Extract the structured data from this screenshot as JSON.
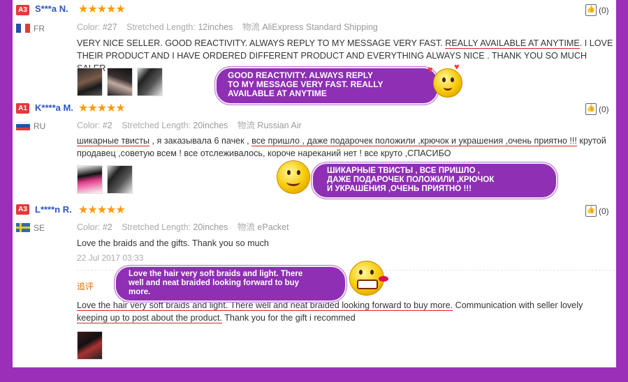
{
  "reviews": [
    {
      "badge": "A3",
      "name": "S***a N.",
      "stars": "★★★★★",
      "country": "FR",
      "likes": "(0)",
      "color_label": "Color:",
      "color_value": "#27",
      "length_label": "Stretched Length:",
      "length_value": "12inches",
      "ship_label": "物流",
      "ship_value": "AliExpress Standard Shipping",
      "text_a": "VERY NICE SELLER. GOOD REACTIVITY. ALWAYS REPLY TO MY MESSAGE VERY FAST. ",
      "text_u": "REALLY AVAILABLE AT ANYTIME",
      "text_b": ". I LOVE THEIR PRODUCT AND I HAVE ORDERED DIFFERENT PRODUCT AND EVERYTHING ALWAYS NICE . THANK YOU SO MUCH SALER",
      "bubble": "GOOD REACTIVITY. ALWAYS REPLY\nTO MY MESSAGE VERY FAST. REALLY\nAVAILABLE AT ANYTIME"
    },
    {
      "badge": "A1",
      "name": "K****a M.",
      "stars": "★★★★★",
      "country": "RU",
      "likes": "(0)",
      "color_label": "Color:",
      "color_value": "#2",
      "length_label": "Stretched Length:",
      "length_value": "20inches",
      "ship_label": "物流",
      "ship_value": "Russian Air",
      "t1": "шикарные твисты",
      "t2": " , я заказывала 6 пачек , ",
      "t3": "все пришло , даже подарочек положили ,крючок и украшения ,очень приятно !!!",
      "t4": " крутой продавец ,советую всем ! все отслеживалось, короче нареканий нет ! все круто ,СПАСИБО",
      "bubble": "ШИКАРНЫЕ ТВИСТЫ , ВСЕ ПРИШЛО ,\nДАЖЕ ПОДАРОЧЕК ПОЛОЖИЛИ ,КРЮЧОК\nИ УКРАШЕНИЯ ,ОЧЕНЬ ПРИЯТНО !!!"
    },
    {
      "badge": "A3",
      "name": "L****n R.",
      "stars": "★★★★★",
      "country": "SE",
      "likes": "(0)",
      "color_label": "Color:",
      "color_value": "#2",
      "length_label": "Stretched Length:",
      "length_value": "20inches",
      "ship_label": "物流",
      "ship_value": "ePacket",
      "text": "Love the braids and the gifts. Thank you so much",
      "date": "22 Jul 2017 03:33",
      "followup_label": "追评",
      "f1": "Love the hair very soft braids and light. There well and neat braided looking forward to buy more.",
      "f2": " Communication with seller lovely ",
      "f3": "keeping up to post about the product.",
      "f4": " Thank you for the gift i recommed",
      "bubble": "Love the hair very soft braids and light. There\nwell and neat braided looking forward to buy\nmore."
    }
  ],
  "colors": {
    "frame": "#9b2fb8",
    "bubble": "#8e2fb4",
    "star": "#ff9a00",
    "badge": "#e4393c",
    "name": "#2a57c6"
  }
}
